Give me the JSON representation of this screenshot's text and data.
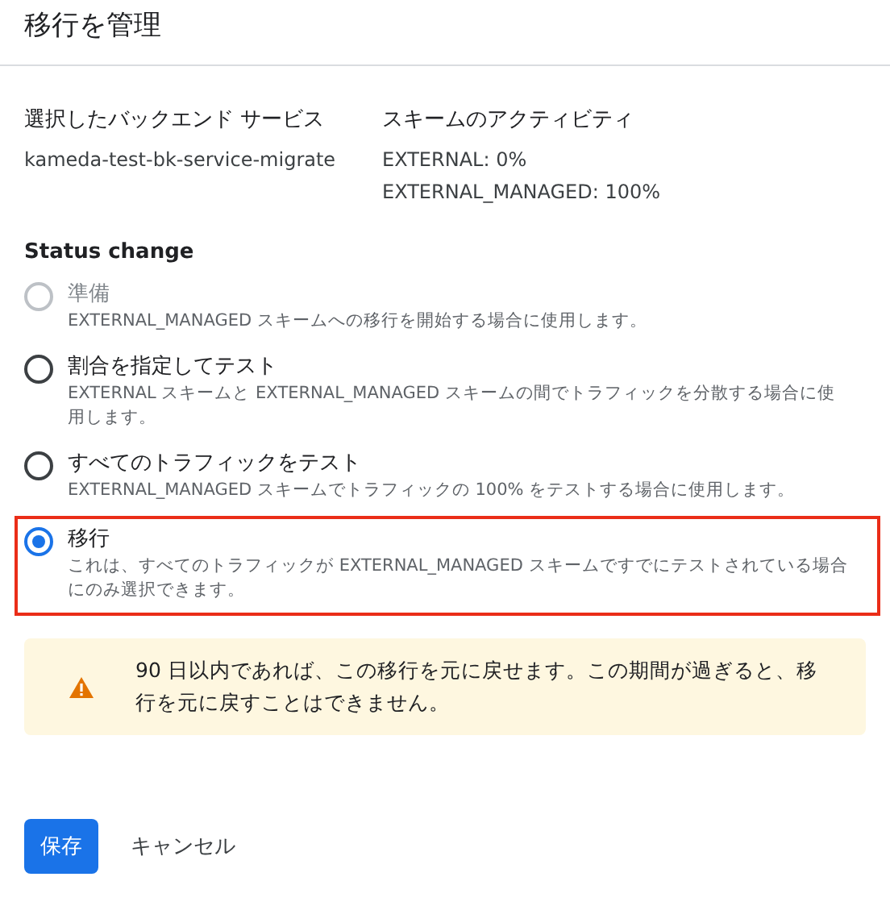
{
  "dialog": {
    "title": "移行を管理"
  },
  "summary": [
    {
      "heading": "選択したバックエンド サービス",
      "lines": [
        "kameda-test-bk-service-migrate"
      ]
    },
    {
      "heading": "スキームのアクティビティ",
      "lines": [
        "EXTERNAL: 0%",
        "EXTERNAL_MANAGED: 100%"
      ]
    }
  ],
  "status_change": {
    "label": "Status change",
    "options": [
      {
        "label": "準備",
        "description": "EXTERNAL_MANAGED スキームへの移行を開始する場合に使用します。",
        "selected": false,
        "disabled": true,
        "highlighted": false
      },
      {
        "label": "割合を指定してテスト",
        "description": "EXTERNAL スキームと EXTERNAL_MANAGED スキームの間でトラフィックを分散する場合に使用します。",
        "selected": false,
        "disabled": false,
        "highlighted": false
      },
      {
        "label": "すべてのトラフィックをテスト",
        "description": "EXTERNAL_MANAGED スキームでトラフィックの 100% をテストする場合に使用します。",
        "selected": false,
        "disabled": false,
        "highlighted": false
      },
      {
        "label": "移行",
        "description": "これは、すべてのトラフィックが EXTERNAL_MANAGED スキームですでにテストされている場合にのみ選択できます。",
        "selected": true,
        "disabled": false,
        "highlighted": true
      }
    ]
  },
  "warning": {
    "text": "90 日以内であれば、この移行を元に戻せます。この期間が過ぎると、移行を元に戻すことはできません。"
  },
  "buttons": [
    {
      "label": "保存",
      "kind": "primary"
    },
    {
      "label": "キャンセル",
      "kind": "text"
    }
  ]
}
